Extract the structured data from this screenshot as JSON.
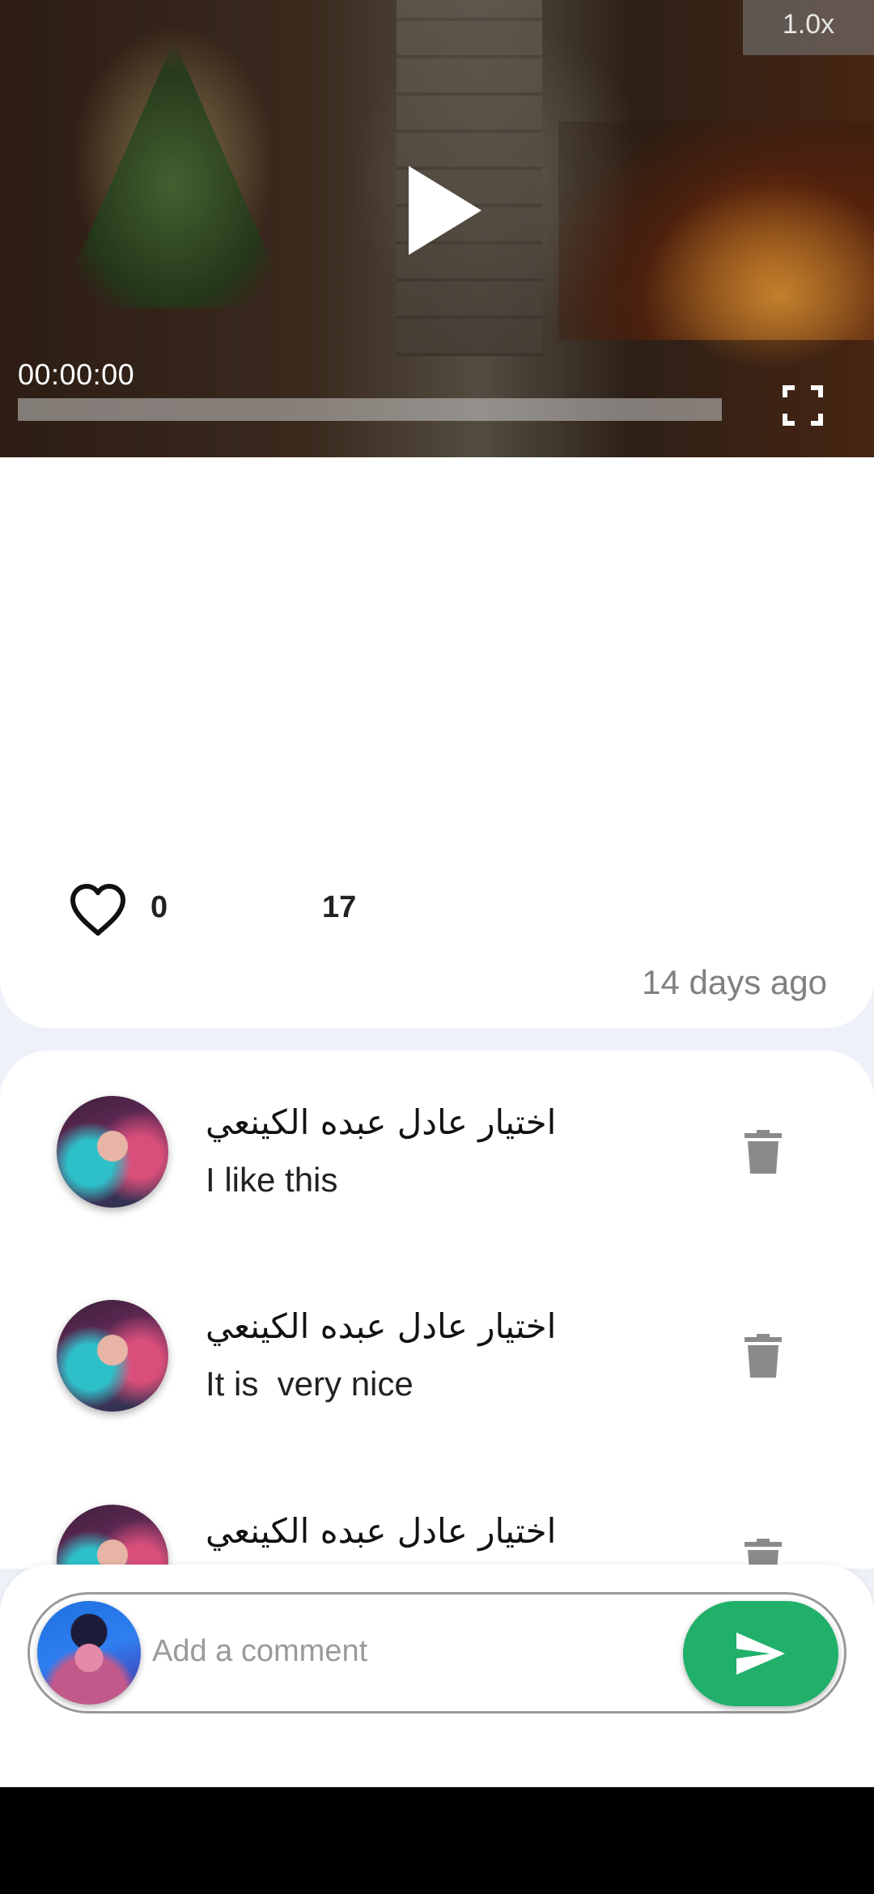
{
  "video": {
    "speed": "1.0x",
    "time": "00:00:00",
    "progress": 0
  },
  "post": {
    "likes": "0",
    "views": "17",
    "time_ago": "14 days ago"
  },
  "comments": [
    {
      "author": "اختيار عادل عبده الكينعي",
      "text": "I like this"
    },
    {
      "author": "اختيار عادل عبده الكينعي",
      "text": "It is  very nice"
    },
    {
      "author": "اختيار عادل عبده الكينعي",
      "text": ""
    }
  ],
  "composer": {
    "placeholder": "Add a comment",
    "value": ""
  },
  "icons": {
    "play": "play-icon",
    "fullscreen": "fullscreen-icon",
    "like": "heart-outline-icon",
    "delete": "trash-icon",
    "send": "send-icon"
  },
  "colors": {
    "send_button": "#21b06a",
    "page_background": "#eef1f7",
    "muted_text": "#808080"
  }
}
